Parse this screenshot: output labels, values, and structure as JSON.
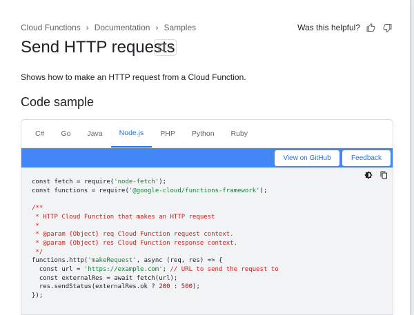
{
  "breadcrumb": [
    "Cloud Functions",
    "Documentation",
    "Samples"
  ],
  "helpful": {
    "label": "Was this helpful?"
  },
  "page": {
    "title": "Send HTTP requests",
    "description": "Shows how to make an HTTP request from a Cloud Function."
  },
  "section": {
    "title": "Code sample"
  },
  "tabs": [
    "C#",
    "Go",
    "Java",
    "Node.js",
    "PHP",
    "Python",
    "Ruby"
  ],
  "active_tab": "Node.js",
  "actions": {
    "github": "View on GitHub",
    "feedback": "Feedback"
  },
  "code": {
    "line1_a": "const fetch = require(",
    "line1_str": "'node-fetch'",
    "line1_b": ");",
    "line2_a": "const functions = require(",
    "line2_str": "'@google-cloud/functions-framework'",
    "line2_b": ");",
    "c1": "/**",
    "c2": " * HTTP Cloud Function that makes an HTTP request",
    "c3": " *",
    "c4": " * @param {Object} req Cloud Function request context.",
    "c5": " * @param {Object} res Cloud Function response context.",
    "c6": " */",
    "l3_a": "functions.http(",
    "l3_str": "'makeRequest'",
    "l3_b": ", async (req, res) => {",
    "l4_a": "  const url = ",
    "l4_str": "'https://example.com'",
    "l4_b": "; ",
    "l4_cmt": "// URL to send the request to",
    "l5": "  const externalRes = await fetch(url);",
    "l6_a": "  res.sendStatus(externalRes.ok ? ",
    "l6_n1": "200",
    "l6_b": " : ",
    "l6_n2": "500",
    "l6_c": ");",
    "l7": "});"
  },
  "colors": {
    "accent": "#1a73e8",
    "bar": "#4285f4",
    "string": "#188038",
    "comment": "#c5221f",
    "number": "#a50e0e"
  },
  "icons": [
    "chevron-right-icon",
    "thumb-up-icon",
    "thumb-down-icon",
    "bookmark-icon",
    "dropdown-arrow-icon",
    "dark-theme-icon",
    "copy-icon"
  ]
}
